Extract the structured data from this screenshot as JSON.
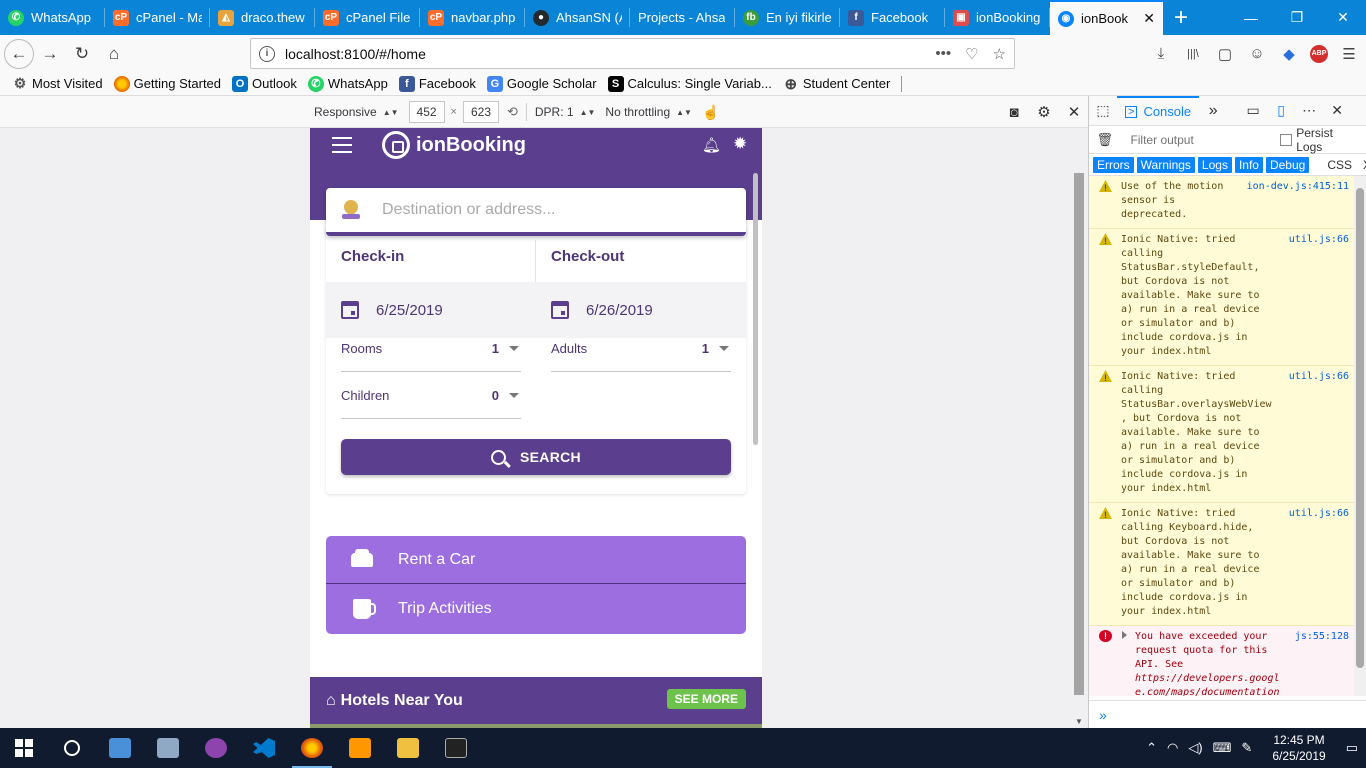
{
  "tabs": [
    {
      "title": "WhatsApp",
      "icon": "whatsapp-icon",
      "color": "#25d366"
    },
    {
      "title": "cPanel - Ma",
      "icon": "cpanel-icon",
      "color": "#ff6c2c"
    },
    {
      "title": "draco.thew",
      "icon": "draco-icon",
      "color": "#e8a33d"
    },
    {
      "title": "cPanel File",
      "icon": "cpanel-icon",
      "color": "#ff6c2c"
    },
    {
      "title": "navbar.php",
      "icon": "cpanel-icon",
      "color": "#ff6c2c"
    },
    {
      "title": "AhsanSN (A",
      "icon": "github-icon",
      "color": "#24292e"
    },
    {
      "title": "Projects - Ahsa",
      "icon": "",
      "color": ""
    },
    {
      "title": "En iyi fikirle",
      "icon": "fb-ideas-icon",
      "color": "#3b9c3b"
    },
    {
      "title": "Facebook",
      "icon": "facebook-icon",
      "color": "#3b5998"
    },
    {
      "title": "ionBooking",
      "icon": "ionbooking-icon",
      "color": "#e04c4c"
    }
  ],
  "active_tab": {
    "title": "ionBook",
    "close": "✕"
  },
  "new_tab_label": "+",
  "window_controls": {
    "minimize": "—",
    "restore": "❐",
    "close": "✕"
  },
  "nav": {
    "back": "←",
    "forward": "→",
    "reload": "↻",
    "home": "⌂",
    "url": "localhost:8100/#/home",
    "url_info": "i",
    "url_icons": [
      "•••",
      "♡",
      "☆"
    ],
    "right_tools": [
      "⤓",
      "|||\\",
      "▢",
      "☺",
      "◆",
      "ABP",
      "☰"
    ]
  },
  "bookmarks": [
    {
      "label": "Most Visited",
      "icon": "gear-icon",
      "glyph": "⚙",
      "color": "#555"
    },
    {
      "label": "Getting Started",
      "icon": "firefox-icon",
      "glyph": "●",
      "color": "#e66000"
    },
    {
      "label": "Outlook",
      "icon": "outlook-icon",
      "glyph": "O",
      "color": "#0072c6"
    },
    {
      "label": "WhatsApp",
      "icon": "whatsapp-icon",
      "glyph": "✆",
      "color": "#25d366"
    },
    {
      "label": "Facebook",
      "icon": "facebook-icon",
      "glyph": "f",
      "color": "#3b5998"
    },
    {
      "label": "Google Scholar",
      "icon": "scholar-icon",
      "glyph": "G",
      "color": "#4285f4"
    },
    {
      "label": "Calculus: Single Variab...",
      "icon": "coursera-icon",
      "glyph": "S",
      "color": "#000"
    },
    {
      "label": "Student Center",
      "icon": "globe-icon",
      "glyph": "⊕",
      "color": "#555"
    }
  ],
  "rdm": {
    "device": "Responsive",
    "width": "452",
    "height": "623",
    "x_sep": "×",
    "dpr": "DPR: 1",
    "throttle": "No throttling"
  },
  "app": {
    "brand": "ionBooking",
    "destination_placeholder": "Destination or address...",
    "checkin_label": "Check-in",
    "checkin_date": "6/25/2019",
    "checkout_label": "Check-out",
    "checkout_date": "6/26/2019",
    "rooms_label": "Rooms",
    "rooms_value": "1",
    "adults_label": "Adults",
    "adults_value": "1",
    "children_label": "Children",
    "children_value": "0",
    "search_label": "SEARCH",
    "rent_car_label": "Rent a Car",
    "trip_activities_label": "Trip Activities",
    "hotels_near_label": "Hotels Near You",
    "see_more_label": "SEE MORE"
  },
  "devtools": {
    "console_tab": "Console",
    "more_tabs": "»",
    "filter_placeholder": "Filter output",
    "persist_label": "Persist Logs",
    "levels": [
      "Errors",
      "Warnings",
      "Logs",
      "Info",
      "Debug"
    ],
    "extra_levels": [
      "CSS",
      "X"
    ],
    "messages": [
      {
        "type": "warn",
        "location": "ion-dev.js:415:11",
        "text": "Use of the motion\nsensor is\ndeprecated."
      },
      {
        "type": "warn",
        "location": "util.js:66",
        "text": "Ionic Native: tried\ncalling\nStatusBar.styleDefault,\nbut Cordova is not\navailable. Make sure to\na) run in a real device\nor simulator and b)\ninclude cordova.js in\nyour index.html"
      },
      {
        "type": "warn",
        "location": "util.js:66",
        "text": "Ionic Native: tried\ncalling\nStatusBar.overlaysWebView\n, but Cordova is not\navailable. Make sure to\na) run in a real device\nor simulator and b)\ninclude cordova.js in\nyour index.html"
      },
      {
        "type": "warn",
        "location": "util.js:66",
        "text": "Ionic Native: tried\ncalling Keyboard.hide,\nbut Cordova is not\navailable. Make sure to\na) run in a real device\nor simulator and b)\ninclude cordova.js in\nyour index.html"
      },
      {
        "type": "err",
        "location": "js:55:128",
        "text": "You have exceeded your\nrequest quota for this\nAPI. See",
        "link": "https://developers.googl\ne.com/maps/documentation\n/javascript/error-"
      }
    ],
    "prompt": "»"
  },
  "taskbar": {
    "apps": [
      "windows-start-icon",
      "cortana-icon",
      "explorer-folder-icon",
      "control-panel-icon",
      "github-desktop-icon",
      "vscode-icon",
      "firefox-icon",
      "sublime-icon",
      "file-explorer-icon",
      "terminal-icon"
    ],
    "time": "12:45 PM",
    "date": "6/25/2019"
  },
  "colors": {
    "app_primary": "#5b3e8e",
    "services_bg": "#9c6ee0",
    "see_more_green": "#6cc24a",
    "firefox_blue": "#0a84d6"
  }
}
